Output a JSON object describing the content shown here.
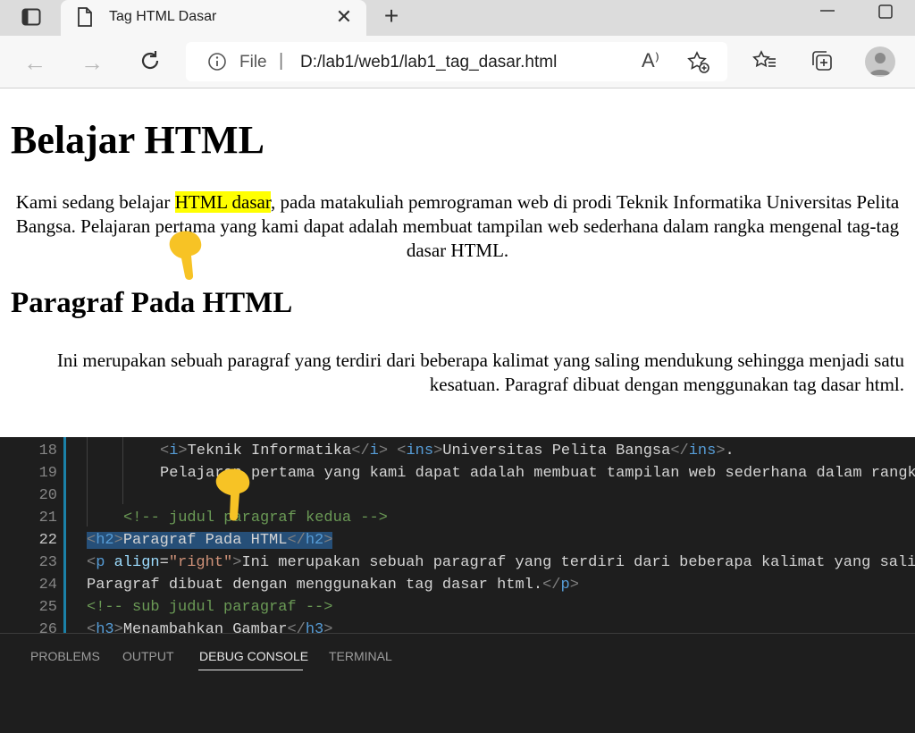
{
  "browser": {
    "tab_title": "Tag HTML Dasar",
    "close_glyph": "✕",
    "new_tab_glyph": "+",
    "address_scheme": "File",
    "address_separator": "|",
    "address_url": "D:/lab1/web1/lab1_tag_dasar.html",
    "read_aloud_glyph": "A⁾",
    "back_glyph": "←",
    "forward_glyph": "→"
  },
  "page": {
    "h1": "Belajar HTML",
    "p1_before": "Kami sedang belajar ",
    "p1_highlight": "HTML dasar",
    "p1_after": ", pada matakuliah pemrograman web di prodi Teknik Informatika Universitas Pelita Bangsa. Pelajaran pertama yang kami dapat adalah membuat tampilan web sederhana dalam rangka mengenal tag-tag dasar HTML.",
    "h2": "Paragraf Pada HTML",
    "p2": "Ini merupakan sebuah paragraf yang terdiri dari beberapa kalimat yang saling mendukung sehingga menjadi satu kesatuan. Paragraf dibuat dengan menggunakan tag dasar html."
  },
  "editor": {
    "line_numbers": [
      "18",
      "19",
      "20",
      "21",
      "22",
      "23",
      "24",
      "25",
      "26"
    ],
    "active_line": "22",
    "l18": {
      "o1": "<",
      "t1": "i",
      "c1": ">",
      "text1": "Teknik Informatika",
      "o2": "</",
      "t2": "i",
      "c2": ">",
      "sp": " ",
      "o3": "<",
      "t3": "ins",
      "c3": ">",
      "text2": "Universitas Pelita Bangsa",
      "o4": "</",
      "t4": "ins",
      "c4": ">",
      "tail": "."
    },
    "l19": "Pelajaran pertama yang kami dapat adalah membuat tampilan web sederhana dalam rangka",
    "l21": "<!-- judul paragraf kedua -->",
    "l22": {
      "o1": "<",
      "t1": "h2",
      "c1": ">",
      "text": "Paragraf Pada HTML",
      "o2": "</",
      "t2": "h2",
      "c2": ">"
    },
    "l23": {
      "o1": "<",
      "t1": "p",
      "attr": " align",
      "eq": "=",
      "val": "\"right\"",
      "c1": ">",
      "text": "Ini merupakan sebuah paragraf yang terdiri dari beberapa kalimat yang saling"
    },
    "l24": {
      "text": "Paragraf dibuat dengan menggunakan tag dasar html.",
      "o1": "</",
      "t1": "p",
      "c1": ">"
    },
    "l25": "<!-- sub judul paragraf -->",
    "l26": {
      "o1": "<",
      "t1": "h3",
      "c1": ">",
      "text": "Menambahkan Gambar",
      "o2": "</",
      "t2": "h3",
      "c2": ">"
    }
  },
  "panel": {
    "tabs": [
      "PROBLEMS",
      "OUTPUT",
      "DEBUG CONSOLE",
      "TERMINAL"
    ],
    "active_tab": "DEBUG CONSOLE"
  },
  "colors": {
    "highlight": "#ffff00",
    "selection": "#264f78",
    "pointer": "#f7c325"
  },
  "icons": [
    "tab-actions-icon",
    "page-icon",
    "close-icon",
    "new-tab-icon",
    "minimize-icon",
    "maximize-icon",
    "back-arrow-icon",
    "forward-arrow-icon",
    "reload-icon",
    "info-icon",
    "read-aloud-icon",
    "add-favorite-icon",
    "favorites-icon",
    "collections-icon",
    "profile-avatar-icon",
    "hand-pointer-icon"
  ]
}
